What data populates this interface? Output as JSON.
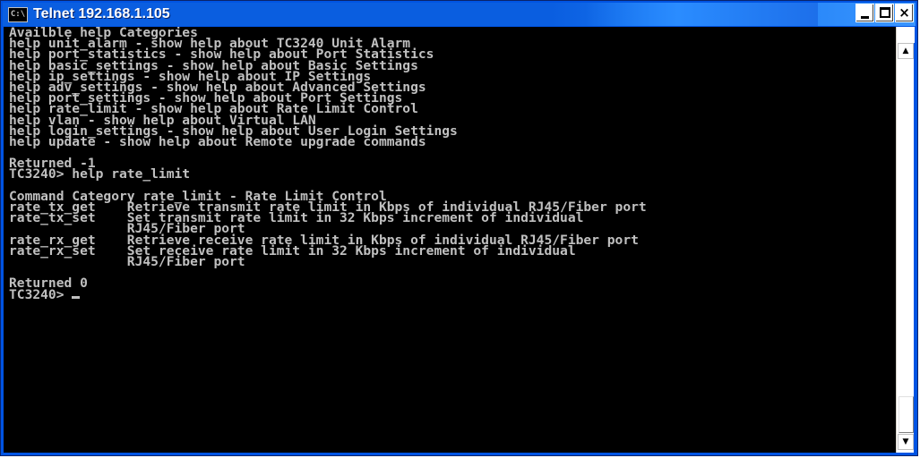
{
  "window": {
    "title": "Telnet 192.168.1.105",
    "icon_label": "C:\\",
    "minimize_glyph": "_",
    "maximize_glyph": "□",
    "close_glyph": "×"
  },
  "console": {
    "lines": [
      "Availble help Categories",
      "help unit_alarm - show help about TC3240 Unit Alarm",
      "help port_statistics - show help about Port Statistics",
      "help basic_settings - show help about Basic Settings",
      "help ip_settings - show help about IP Settings",
      "help adv_settings - show help about Advanced Settings",
      "help port_settings - show help about Port Settings",
      "help rate_limit - show help about Rate Limit Control",
      "help vlan - show help about Virtual LAN",
      "help login_settings - show help about User Login Settings",
      "help update - show help about Remote upgrade commands",
      "",
      "Returned -1",
      "TC3240> help rate_limit",
      "",
      "Command Category rate_limit - Rate Limit Control",
      "rate_tx_get    Retrieve transmit rate limit in Kbps of individual RJ45/Fiber port",
      "rate_tx_set    Set transmit rate limit in 32 Kbps increment of individual",
      "               RJ45/Fiber port",
      "rate_rx_get    Retrieve receive rate limit in Kbps of individual RJ45/Fiber port",
      "rate_rx_set    Set receive rate limit in 32 Kbps increment of individual",
      "               RJ45/Fiber port",
      "",
      "Returned 0"
    ],
    "prompt": "TC3240> "
  },
  "scrollbar": {
    "up_arrow": "▲",
    "down_arrow": "▼"
  },
  "colors": {
    "titlebar": "#0a5ee0",
    "console_bg": "#000000",
    "console_fg": "#c0c0c0"
  }
}
